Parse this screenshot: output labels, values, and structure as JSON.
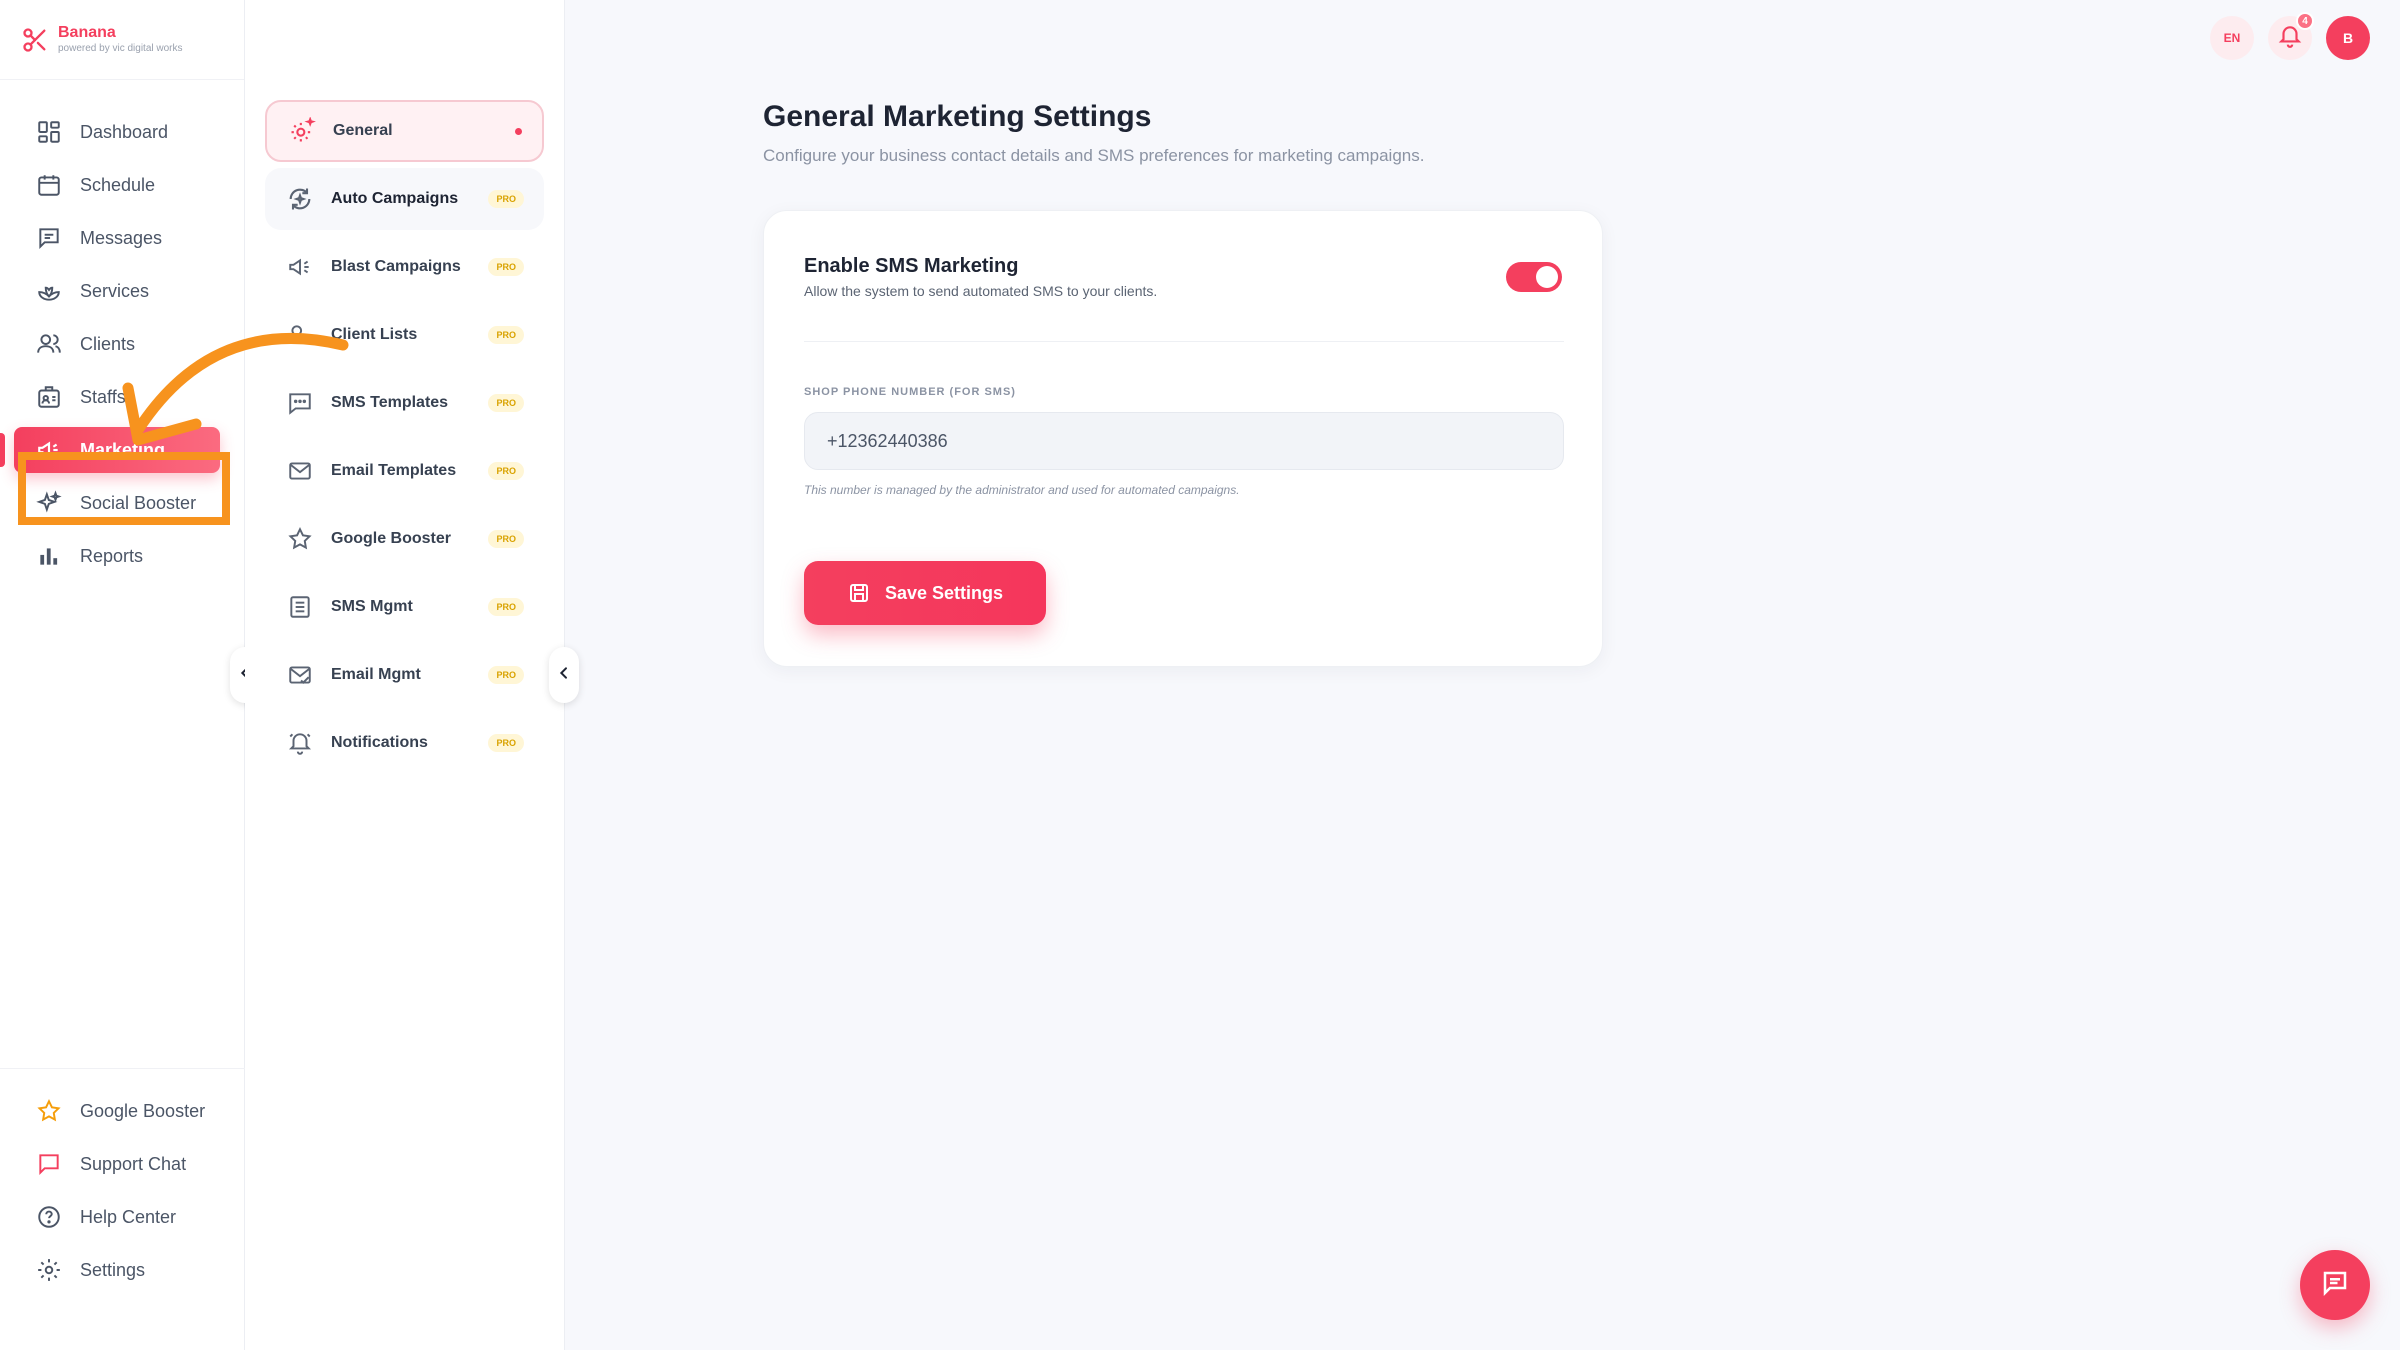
{
  "brand": {
    "name": "Banana",
    "tagline": "powered by vic digital works"
  },
  "sidebar": {
    "items": [
      {
        "label": "Dashboard",
        "icon": "dashboard-icon"
      },
      {
        "label": "Schedule",
        "icon": "calendar-icon"
      },
      {
        "label": "Messages",
        "icon": "message-icon"
      },
      {
        "label": "Services",
        "icon": "lotus-icon"
      },
      {
        "label": "Clients",
        "icon": "users-icon"
      },
      {
        "label": "Staffs",
        "icon": "id-badge-icon"
      },
      {
        "label": "Marketing",
        "icon": "megaphone-icon",
        "active": true
      },
      {
        "label": "Social Booster",
        "icon": "sparkles-icon"
      },
      {
        "label": "Reports",
        "icon": "bar-chart-icon"
      }
    ],
    "bottom_items": [
      {
        "label": "Google Booster",
        "icon": "star-icon"
      },
      {
        "label": "Support Chat",
        "icon": "chat-icon"
      },
      {
        "label": "Help Center",
        "icon": "help-icon"
      },
      {
        "label": "Settings",
        "icon": "gear-icon"
      }
    ]
  },
  "subnav": {
    "items": [
      {
        "label": "General",
        "icon": "settings-sparkle-icon",
        "active": true
      },
      {
        "label": "Auto Campaigns",
        "icon": "refresh-sparkle-icon",
        "badge": "PRO"
      },
      {
        "label": "Blast Campaigns",
        "icon": "megaphone-icon",
        "badge": "PRO"
      },
      {
        "label": "Client Lists",
        "icon": "users-icon",
        "badge": "PRO"
      },
      {
        "label": "SMS Templates",
        "icon": "sms-icon",
        "badge": "PRO"
      },
      {
        "label": "Email Templates",
        "icon": "mail-icon",
        "badge": "PRO"
      },
      {
        "label": "Google Booster",
        "icon": "star-icon",
        "badge": "PRO"
      },
      {
        "label": "SMS Mgmt",
        "icon": "list-icon",
        "badge": "PRO"
      },
      {
        "label": "Email Mgmt",
        "icon": "mail-check-icon",
        "badge": "PRO"
      },
      {
        "label": "Notifications",
        "icon": "bell-icon",
        "badge": "PRO"
      }
    ]
  },
  "main": {
    "title": "General Marketing Settings",
    "subtitle": "Configure your business contact details and SMS preferences for marketing campaigns.",
    "sms": {
      "title": "Enable SMS Marketing",
      "description": "Allow the system to send automated SMS to your clients.",
      "enabled": true
    },
    "phone": {
      "label": "SHOP PHONE NUMBER (FOR SMS)",
      "value": "+12362440386",
      "note": "This number is managed by the administrator and used for automated campaigns."
    },
    "save_label": "Save Settings"
  },
  "header": {
    "language": "EN",
    "notification_count": "4",
    "avatar_initial": "B"
  },
  "colors": {
    "accent": "#f43f5e",
    "annotation": "#f7931e",
    "pro_badge": "#d9a200"
  }
}
